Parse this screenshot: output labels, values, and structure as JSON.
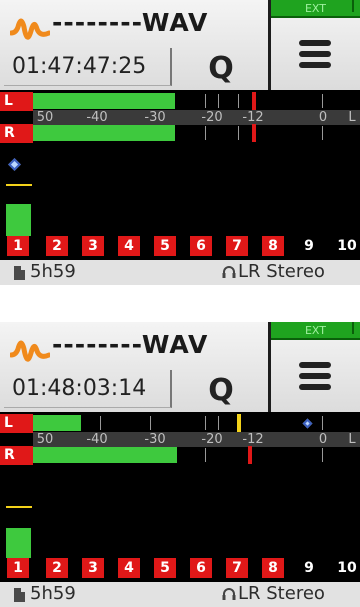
{
  "screens": [
    {
      "file_name": "--------WAV",
      "timecode": "01:47:47:25",
      "q_label": "Q",
      "ext_label": "EXT",
      "channels": {
        "left": "L",
        "right": "R"
      },
      "scale_labels": [
        "50",
        "-40",
        "-30",
        "-20",
        "-12",
        "0",
        "L"
      ],
      "levels": {
        "left_db": -30,
        "right_db": -30
      },
      "peak_hold": {
        "color": "#e01818",
        "db": -12
      },
      "tracks": [
        "1",
        "2",
        "3",
        "4",
        "5",
        "6",
        "7",
        "8",
        "9",
        "10"
      ],
      "armed_tracks": 8,
      "remaining": "5h59",
      "monitor": "LR Stereo"
    },
    {
      "file_name": "--------WAV",
      "timecode": "01:48:03:14",
      "q_label": "Q",
      "ext_label": "EXT",
      "channels": {
        "left": "L",
        "right": "R"
      },
      "scale_labels": [
        "50",
        "-40",
        "-30",
        "-20",
        "-12",
        "0",
        "L"
      ],
      "levels": {
        "left_db": -42,
        "right_db": -30
      },
      "peak_hold": {
        "color": "#e01818",
        "db": -12
      },
      "tracks": [
        "1",
        "2",
        "3",
        "4",
        "5",
        "6",
        "7",
        "8",
        "9",
        "10"
      ],
      "armed_tracks": 8,
      "remaining": "5h59",
      "monitor": "LR Stereo"
    }
  ],
  "icons": {
    "logo": "waveform-logo-icon",
    "menu": "hamburger-menu-icon",
    "media": "document-icon",
    "monitor": "headphones-icon"
  },
  "colors": {
    "meter_green": "#3ec93e",
    "armed_red": "#e01818",
    "ext_green": "#1fa31f",
    "logo_orange": "#f08a1c"
  }
}
